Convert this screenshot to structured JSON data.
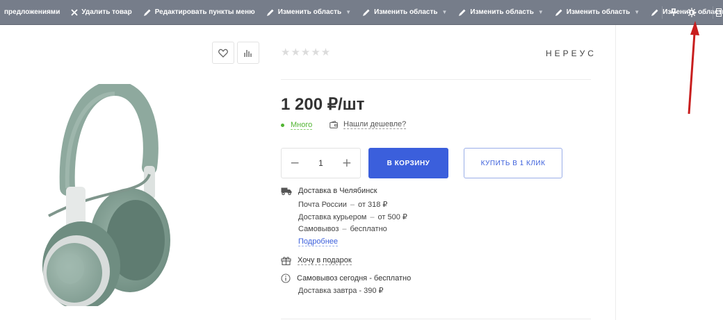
{
  "toolbar": {
    "items": [
      {
        "label": "предложениями",
        "icon": "none"
      },
      {
        "label": "Удалить товар",
        "icon": "close-icon"
      },
      {
        "label": "Редактировать пункты меню",
        "icon": "pencil-icon"
      },
      {
        "label": "Изменить область",
        "icon": "pencil-icon"
      },
      {
        "label": "Изменить область",
        "icon": "pencil-icon"
      },
      {
        "label": "Изменить область",
        "icon": "pencil-icon"
      },
      {
        "label": "Изменить область",
        "icon": "pencil-icon"
      },
      {
        "label": "Изменить область",
        "icon": "pencil-icon"
      }
    ],
    "right_icons": [
      "pin-icon",
      "gear-icon",
      "chevron-down-icon"
    ]
  },
  "product": {
    "rating_stars": "★★★★★",
    "rating_value": 0,
    "brand": "НЕРЕУС",
    "price": "1 200 ₽/шт",
    "stock_label": "Много",
    "cheaper_label": "Нашли дешевле?",
    "quantity": "1",
    "add_to_cart": "В КОРЗИНУ",
    "buy_one_click": "КУПИТЬ В 1 КЛИК"
  },
  "delivery": {
    "title": "Доставка в Челябинск",
    "options": [
      {
        "name": "Почта России",
        "sep": "–",
        "price": "от 318 ₽"
      },
      {
        "name": "Доставка курьером",
        "sep": "–",
        "price": "от 500 ₽"
      },
      {
        "name": "Самовывоз",
        "sep": "–",
        "price": "бесплатно"
      }
    ],
    "more_link": "Подробнее"
  },
  "gift": {
    "label": "Хочу в подарок"
  },
  "info": {
    "line1": "Самовывоз сегодня - бесплатно",
    "line2": "Доставка завтра - 390 ₽"
  },
  "colors": {
    "toolbar_bg": "#767d8a",
    "accent_blue": "#3b5fdc",
    "stock_green": "#52b533",
    "annotation_red": "#c81e1e"
  }
}
